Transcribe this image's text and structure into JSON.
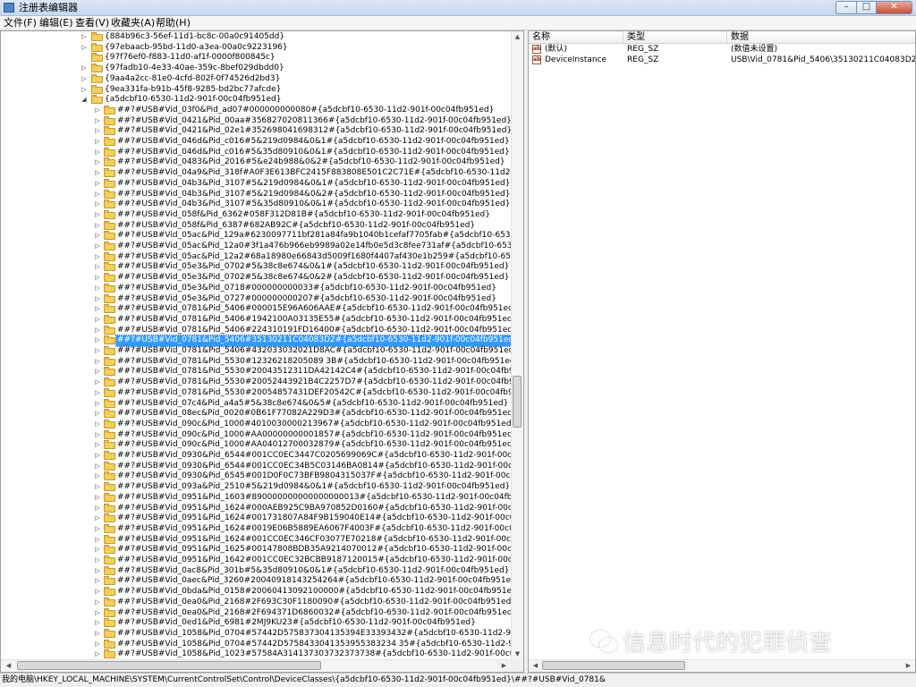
{
  "window": {
    "title": "注册表编辑器",
    "minimize": "–",
    "maximize": "□",
    "close": "✕"
  },
  "menu": [
    "文件(F)",
    "编辑(E)",
    "查看(V)",
    "收藏夹(A)",
    "帮助(H)"
  ],
  "tree": {
    "rows": [
      {
        "label": "{884b96c3-56ef-11d1-bc8c-00a0c91405dd}",
        "level": 0,
        "expander": "▷",
        "selected": false
      },
      {
        "label": "{97ebaacb-95bd-11d0-a3ea-00a0c9223196}",
        "level": 0,
        "expander": "▷",
        "selected": false
      },
      {
        "label": "{97f76ef0-f883-11d0-af1f-0000f800845c}",
        "level": 0,
        "expander": "",
        "selected": false
      },
      {
        "label": "{97fadb10-4e33-40ae-359c-8bef029dbdd0}",
        "level": 0,
        "expander": "▷",
        "selected": false
      },
      {
        "label": "{9aa4a2cc-81e0-4cfd-802f-0f74526d2bd3}",
        "level": 0,
        "expander": "▷",
        "selected": false
      },
      {
        "label": "{9ea331fa-b91b-45f8-9285-bd2bc77afcde}",
        "level": 0,
        "expander": "▷",
        "selected": false
      },
      {
        "label": "{a5dcbf10-6530-11d2-901f-00c04fb951ed}",
        "level": 0,
        "expander": "◢",
        "selected": false
      },
      {
        "label": "##?#USB#Vid_03f0&Pid_ad07#000000000080#{a5dcbf10-6530-11d2-901f-00c04fb951ed}",
        "level": 1,
        "expander": "▷",
        "selected": false
      },
      {
        "label": "##?#USB#Vid_0421&Pid_00aa#356827020811366#{a5dcbf10-6530-11d2-901f-00c04fb951ed}",
        "level": 1,
        "expander": "▷",
        "selected": false
      },
      {
        "label": "##?#USB#Vid_0421&Pid_02e1#352698041698312#{a5dcbf10-6530-11d2-901f-00c04fb951ed}",
        "level": 1,
        "expander": "▷",
        "selected": false
      },
      {
        "label": "##?#USB#Vid_046d&Pid_c016#5&219d0984&0&1#{a5dcbf10-6530-11d2-901f-00c04fb951ed}",
        "level": 1,
        "expander": "▷",
        "selected": false
      },
      {
        "label": "##?#USB#Vid_046d&Pid_c016#5&35d80910&0&1#{a5dcbf10-6530-11d2-901f-00c04fb951ed}",
        "level": 1,
        "expander": "▷",
        "selected": false
      },
      {
        "label": "##?#USB#Vid_0483&Pid_2016#5&e24b988&0&2#{a5dcbf10-6530-11d2-901f-00c04fb951ed}",
        "level": 1,
        "expander": "▷",
        "selected": false
      },
      {
        "label": "##?#USB#Vid_04a9&Pid_318f#A0F3E613BFC2415F883808E501C2C71E#{a5dcbf10-6530-11d2-901f-00c04f",
        "level": 1,
        "expander": "▷",
        "selected": false
      },
      {
        "label": "##?#USB#Vid_04b3&Pid_3107#5&219d0984&0&1#{a5dcbf10-6530-11d2-901f-00c04fb951ed}",
        "level": 1,
        "expander": "▷",
        "selected": false
      },
      {
        "label": "##?#USB#Vid_04b3&Pid_3107#5&219d0984&0&2#{a5dcbf10-6530-11d2-901f-00c04fb951ed}",
        "level": 1,
        "expander": "▷",
        "selected": false
      },
      {
        "label": "##?#USB#Vid_04b3&Pid_3107#5&35d80910&0&1#{a5dcbf10-6530-11d2-901f-00c04fb951ed}",
        "level": 1,
        "expander": "▷",
        "selected": false
      },
      {
        "label": "##?#USB#Vid_058f&Pid_6362#058F312D81B#{a5dcbf10-6530-11d2-901f-00c04fb951ed}",
        "level": 1,
        "expander": "▷",
        "selected": false
      },
      {
        "label": "##?#USB#Vid_058f&Pid_6387#682AB92C#{a5dcbf10-6530-11d2-901f-00c04fb951ed}",
        "level": 1,
        "expander": "▷",
        "selected": false
      },
      {
        "label": "##?#USB#Vid_05ac&Pid_129a#6230097711bf281a84fa9b1040b1cefaf7705fab#{a5dcbf10-6530-11d2-901f-",
        "level": 1,
        "expander": "▷",
        "selected": false
      },
      {
        "label": "##?#USB#Vid_05ac&Pid_12a0#3f1a476b966eb9989a02e14fb0e5d3c8fee731af#{a5dcbf10-6530-11d2-901f",
        "level": 1,
        "expander": "▷",
        "selected": false
      },
      {
        "label": "##?#USB#Vid_05ac&Pid_12a2#68a18980e66843d5009f1680f4407af430e1b259#{a5dcbf10-6530-11d2-901",
        "level": 1,
        "expander": "▷",
        "selected": false
      },
      {
        "label": "##?#USB#Vid_05e3&Pid_0702#5&38c8e674&0&1#{a5dcbf10-6530-11d2-901f-00c04fb951ed}",
        "level": 1,
        "expander": "▷",
        "selected": false
      },
      {
        "label": "##?#USB#Vid_05e3&Pid_0702#5&38c8e674&0&2#{a5dcbf10-6530-11d2-901f-00c04fb951ed}",
        "level": 1,
        "expander": "▷",
        "selected": false
      },
      {
        "label": "##?#USB#Vid_05e3&Pid_0718#000000000033#{a5dcbf10-6530-11d2-901f-00c04fb951ed}",
        "level": 1,
        "expander": "▷",
        "selected": false
      },
      {
        "label": "##?#USB#Vid_05e3&Pid_0727#000000000207#{a5dcbf10-6530-11d2-901f-00c04fb951ed}",
        "level": 1,
        "expander": "▷",
        "selected": false
      },
      {
        "label": "##?#USB#Vid_0781&Pid_5406#000015E96A606AAE#{a5dcbf10-6530-11d2-901f-00c04fb951ed}",
        "level": 1,
        "expander": "▷",
        "selected": false
      },
      {
        "label": "##?#USB#Vid_0781&Pid_5406#1942100A03135E55#{a5dcbf10-6530-11d2-901f-00c04fb951ed}",
        "level": 1,
        "expander": "▷",
        "selected": false
      },
      {
        "label": "##?#USB#Vid_0781&Pid_5406#224310191FD16400#{a5dcbf10-6530-11d2-901f-00c04fb951ed}",
        "level": 1,
        "expander": "▷",
        "selected": false
      },
      {
        "label": "##?#USB#Vid_0781&Pid_5406#35130211C04083D2#{a5dcbf10-6530-11d2-901f-00c04fb951ed}",
        "level": 1,
        "expander": "▷",
        "selected": true
      },
      {
        "label": "##?#USB#Vid_0781&Pid_5406#432033032021D8AC#{a5dcbf10-6530-11d2-901f-00c04fb951ed}",
        "level": 1,
        "expander": "▷",
        "selected": false
      },
      {
        "label": "##?#USB#Vid_0781&Pid_5530#12326218205089 3B#{a5dcbf10-6530-11d2-901f-00c04fb951ed}",
        "level": 1,
        "expander": "▷",
        "selected": false
      },
      {
        "label": "##?#USB#Vid_0781&Pid_5530#20043512311DA42142C4#{a5dcbf10-6530-11d2-901f-00c04fb951ed}",
        "level": 1,
        "expander": "▷",
        "selected": false
      },
      {
        "label": "##?#USB#Vid_0781&Pid_5530#20052443921B4C2257D7#{a5dcbf10-6530-11d2-901f-00c04fb951ed}",
        "level": 1,
        "expander": "▷",
        "selected": false
      },
      {
        "label": "##?#USB#Vid_0781&Pid_5530#20054857431DEF20542C#{a5dcbf10-6530-11d2-901f-00c04fb951ed}",
        "level": 1,
        "expander": "▷",
        "selected": false
      },
      {
        "label": "##?#USB#Vid_07c4&Pid_a4a5#5&38c8e674&0&5#{a5dcbf10-6530-11d2-901f-00c04fb951ed}",
        "level": 1,
        "expander": "▷",
        "selected": false
      },
      {
        "label": "##?#USB#Vid_08ec&Pid_0020#0B61F77082A229D3#{a5dcbf10-6530-11d2-901f-00c04fb951ed}",
        "level": 1,
        "expander": "▷",
        "selected": false
      },
      {
        "label": "##?#USB#Vid_090c&Pid_1000#4010030000213967#{a5dcbf10-6530-11d2-901f-00c04fb951ed}",
        "level": 1,
        "expander": "▷",
        "selected": false
      },
      {
        "label": "##?#USB#Vid_090c&Pid_1000#AA00000000001857#{a5dcbf10-6530-11d2-901f-00c04fb951ed}",
        "level": 1,
        "expander": "▷",
        "selected": false
      },
      {
        "label": "##?#USB#Vid_090c&Pid_1000#AA04012700032879#{a5dcbf10-6530-11d2-901f-00c04fb951ed}",
        "level": 1,
        "expander": "▷",
        "selected": false
      },
      {
        "label": "##?#USB#Vid_0930&Pid_6544#001CC0EC3447C0205699069C#{a5dcbf10-6530-11d2-901f-00c04fb951ed}",
        "level": 1,
        "expander": "▷",
        "selected": false
      },
      {
        "label": "##?#USB#Vid_0930&Pid_6544#001CC0EC34B5C03146BA0814#{a5dcbf10-6530-11d2-901f-00c04fb951ed}",
        "level": 1,
        "expander": "▷",
        "selected": false
      },
      {
        "label": "##?#USB#Vid_0930&Pid_6545#001D0F0C73BFB9804315037F#{a5dcbf10-6530-11d2-901f-00c04fb951ed}",
        "level": 1,
        "expander": "▷",
        "selected": false
      },
      {
        "label": "##?#USB#Vid_093a&Pid_2510#5&219d0984&0&1#{a5dcbf10-6530-11d2-901f-00c04fb951ed}",
        "level": 1,
        "expander": "▷",
        "selected": false
      },
      {
        "label": "##?#USB#Vid_0951&Pid_1603#890000000000000000013#{a5dcbf10-6530-11d2-901f-00c04fb951ed}",
        "level": 1,
        "expander": "▷",
        "selected": false
      },
      {
        "label": "##?#USB#Vid_0951&Pid_1624#000AEB925C9BA970852D0160#{a5dcbf10-6530-11d2-901f-00c04fb951ed}",
        "level": 1,
        "expander": "▷",
        "selected": false
      },
      {
        "label": "##?#USB#Vid_0951&Pid_1624#001731807A84F9B159040E14#{a5dcbf10-6530-11d2-901f-00c04fb951ed}",
        "level": 1,
        "expander": "▷",
        "selected": false
      },
      {
        "label": "##?#USB#Vid_0951&Pid_1624#0019E06B5889EA6067F4003F#{a5dcbf10-6530-11d2-901f-00c04fb951ed}",
        "level": 1,
        "expander": "▷",
        "selected": false
      },
      {
        "label": "##?#USB#Vid_0951&Pid_1624#001CC0EC346CF03077E70218#{a5dcbf10-6530-11d2-901f-00c04fb951ed}",
        "level": 1,
        "expander": "▷",
        "selected": false
      },
      {
        "label": "##?#USB#Vid_0951&Pid_1625#00147808BDB35A9214070012#{a5dcbf10-6530-11d2-901f-00c04fb951ed}",
        "level": 1,
        "expander": "▷",
        "selected": false
      },
      {
        "label": "##?#USB#Vid_0951&Pid_1642#001CC0EC32BCBB9187120015#{a5dcbf10-6530-11d2-901f-00c04fb951ed}",
        "level": 1,
        "expander": "▷",
        "selected": false
      },
      {
        "label": "##?#USB#Vid_0ac8&Pid_301b#5&35d80910&0&1#{a5dcbf10-6530-11d2-901f-00c04fb951ed}",
        "level": 1,
        "expander": "▷",
        "selected": false
      },
      {
        "label": "##?#USB#Vid_0aec&Pid_3260#20040918143254264#{a5dcbf10-6530-11d2-901f-00c04fb951ed}",
        "level": 1,
        "expander": "▷",
        "selected": false
      },
      {
        "label": "##?#USB#Vid_0bda&Pid_0158#20060413092100000#{a5dcbf10-6530-11d2-901f-00c04fb951ed}",
        "level": 1,
        "expander": "▷",
        "selected": false
      },
      {
        "label": "##?#USB#Vid_0ea0&Pid_2168#2F693C30F1180090#{a5dcbf10-6530-11d2-901f-00c04fb951ed}",
        "level": 1,
        "expander": "▷",
        "selected": false
      },
      {
        "label": "##?#USB#Vid_0ea0&Pid_2168#2F694371D6860032#{a5dcbf10-6530-11d2-901f-00c04fb951ed}",
        "level": 1,
        "expander": "▷",
        "selected": false
      },
      {
        "label": "##?#USB#Vid_0ed1&Pid_6981#2MJ9KU23#{a5dcbf10-6530-11d2-901f-00c04fb951ed}",
        "level": 1,
        "expander": "▷",
        "selected": false
      },
      {
        "label": "##?#USB#Vid_1058&Pid_0704#57442D575837304135394E33393432#{a5dcbf10-6530-11d2-901f-00c04fb",
        "level": 1,
        "expander": "▷",
        "selected": false
      },
      {
        "label": "##?#USB#Vid_1058&Pid_0704#57442D5758433041353955383234 35#{a5dcbf10-6530-11d2-901f-00c04fb",
        "level": 1,
        "expander": "▷",
        "selected": false
      },
      {
        "label": "##?#USB#Vid_1058&Pid_1023#57584A314137303732373738#{a5dcbf10-6530-11d2-901f-00c04fb951ed}",
        "level": 1,
        "expander": "▷",
        "selected": false
      }
    ]
  },
  "values": {
    "columns": [
      "名称",
      "类型",
      "数据"
    ],
    "rows": [
      {
        "icon": "ab",
        "name": "(默认)",
        "type": "REG_SZ",
        "data": "(数值未设置)"
      },
      {
        "icon": "ab",
        "name": "DeviceInstance",
        "type": "REG_SZ",
        "data": "USB\\Vid_0781&Pid_5406\\35130211C04083D2"
      }
    ]
  },
  "status": {
    "path": "我的电脑\\HKEY_LOCAL_MACHINE\\SYSTEM\\CurrentControlSet\\Control\\DeviceClasses\\{a5dcbf10-6530-11d2-901f-00c04fb951ed}\\##?#USB#Vid_0781&"
  },
  "watermark": {
    "text": "信息时代的犯罪侦查"
  },
  "colors": {
    "selection": "#3399ff",
    "folder": "#f2cf60"
  }
}
